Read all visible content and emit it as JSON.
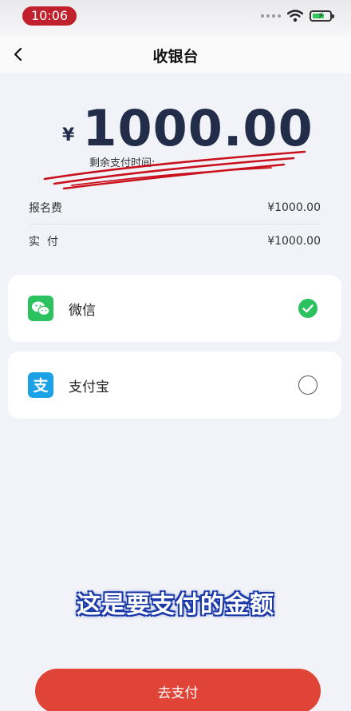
{
  "status_bar": {
    "time": "10:06"
  },
  "nav": {
    "title": "收银台"
  },
  "amount": {
    "currency": "¥",
    "value": "1000.00",
    "remaining_label": "剩余支付时间:"
  },
  "summary": [
    {
      "label": "报名费",
      "value": "¥1000.00"
    },
    {
      "label": "实  付",
      "value": "¥1000.00"
    }
  ],
  "payment_methods": [
    {
      "label": "微信",
      "icon": "wechat-icon",
      "selected": true,
      "color": "#2bc15f"
    },
    {
      "label": "支付宝",
      "icon": "alipay-icon",
      "selected": false,
      "color": "#1aa1e6"
    }
  ],
  "caption": "这是要支付的金额",
  "pay_button": {
    "label": "去支付",
    "color": "#e04437"
  }
}
